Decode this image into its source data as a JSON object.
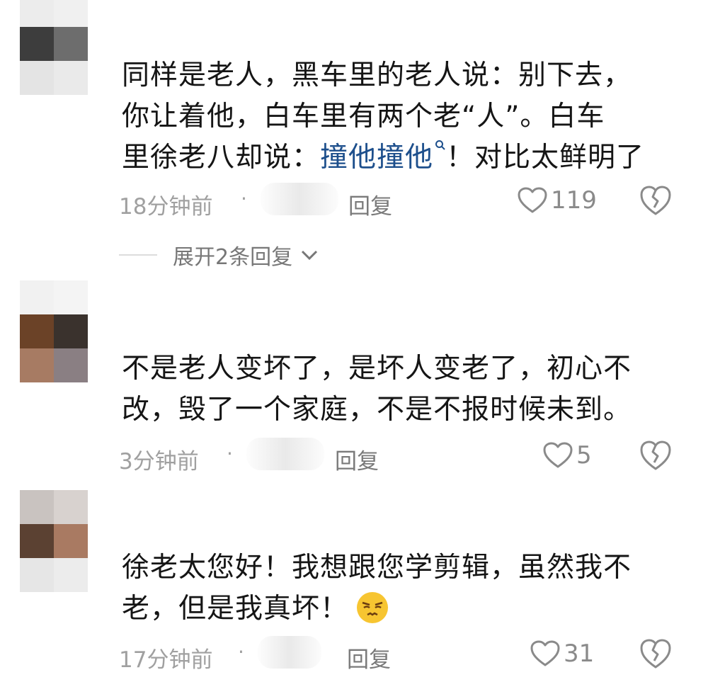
{
  "comments": [
    {
      "lines": [
        "同样是老人，黑车里的老人说：别下去，",
        "你让着他，白车里有两个老“人”。白车"
      ],
      "line3_prefix": "里徐老八却说：",
      "line3_link": "撞他撞他",
      "line3_suffix": "！对比太鲜明了",
      "time": "18分钟前",
      "dot": "·",
      "reply": "回复",
      "likes": "119",
      "expand": "展开2条回复"
    },
    {
      "lines": [
        "不是老人变坏了，是坏人变老了，初心不",
        "改，毁了一个家庭，不是不报时候未到。"
      ],
      "time": "3分钟前",
      "dot": "·",
      "reply": "回复",
      "likes": "5"
    },
    {
      "lines": [
        "徐老太您好！我想跟您学剪辑，虽然我不",
        "老，但是我真坏！"
      ],
      "time": "17分钟前",
      "dot": "·",
      "reply": "回复",
      "likes": "31"
    }
  ],
  "icons": {
    "heart": "heart-outline-icon",
    "dislike": "broken-heart-icon",
    "expand": "chevron-down-icon",
    "search": "search-icon",
    "emoji": "smirk-emoji-icon"
  },
  "colors": {
    "text": "#151515",
    "meta": "#a0a0a0",
    "link": "#1d4f8c",
    "background": "#ffffff"
  }
}
